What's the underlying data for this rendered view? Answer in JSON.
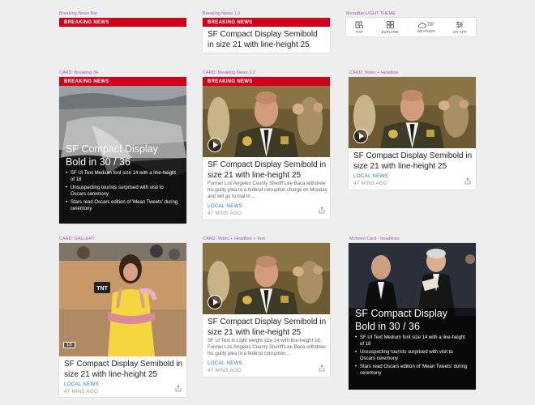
{
  "labels": {
    "breaking_bar": "Breaking News Bar",
    "breaking_news_10": "Breaking News 1.0",
    "menubar": "MenuBar-LIGHT THEME",
    "breaking_34": "CARD: Breaking 34",
    "breaking_22": "CARD: Breaking News 2.2",
    "video_headline": "CARD: Video + Headline",
    "gallery": "CARD: GALLERY",
    "video_headline_text": "CARD: Video + Headline + Text",
    "moment": "Moment Card - headlines"
  },
  "breaking_label": "BREAKING NEWS",
  "menubar": {
    "items": [
      {
        "label": "TOP",
        "icon": "top-news-icon"
      },
      {
        "label": "EXPLORE",
        "icon": "explore-grid-icon"
      },
      {
        "label": "WEATHER",
        "icon": "weather-cloud-icon",
        "temp": "78°"
      },
      {
        "label": "MY APP",
        "icon": "settings-sliders-icon"
      }
    ]
  },
  "card_b10": {
    "headline": "SF Compact Display Semibold in size 21 with line-height 25"
  },
  "card_b34": {
    "headline": "SF Compact Display Bold in 30 / 36",
    "bullets": [
      "SF UI Text Medium font size 14 with a line-height of 18",
      "Unsuspecting tourists surprised with visit to Oscars ceremony",
      "Stars read Oscars edition of 'Mean Tweets' during ceremony"
    ]
  },
  "card_b22": {
    "headline": "SF Compact Display Semibold in size 21 with line-height 25",
    "body": "Former Los Angeles County Sheriff Lee Baca withdrew his guilty plea to a federal corruption charge on Monday and will go to trial in ...",
    "link": "LOCAL NEWS",
    "time": "47 MINS AGO"
  },
  "card_vh": {
    "headline": "SF Compact Display Semibold in size 21 with line-height 25",
    "link": "LOCAL NEWS",
    "time": "47 MINS AGO"
  },
  "card_gallery": {
    "headline": "SF Compact Display Semibold in size 21 with line-height 25",
    "link": "LOCAL NEWS",
    "time": "47 MINS AGO",
    "count": "18",
    "photo_sign": "TNT"
  },
  "card_vht": {
    "headline": "SF Compact Display Semibold in size 21 with line-height 25",
    "body": "SF UI Text in Light weight size 14 with line-height 18. Former Los Angeles County Sheriff Lee Baca withdrew his guilty plea to a federal corruption ...",
    "link": "LOCAL NEWS",
    "time": "47 MINS AGO"
  },
  "card_moment": {
    "headline": "SF Compact Display Bold in 30 / 36",
    "bullets": [
      "SF UI Text Medium font size 14 with a line-height of 18",
      "Unsuspecting tourists surprised with visit to Oscars ceremony",
      "Stars read Oscars edition of 'Mean Tweets' during ceremony"
    ]
  },
  "colors": {
    "breaking_red": "#d0021b",
    "link_blue": "#2a7fc7",
    "label_purple": "#a05ab6"
  }
}
